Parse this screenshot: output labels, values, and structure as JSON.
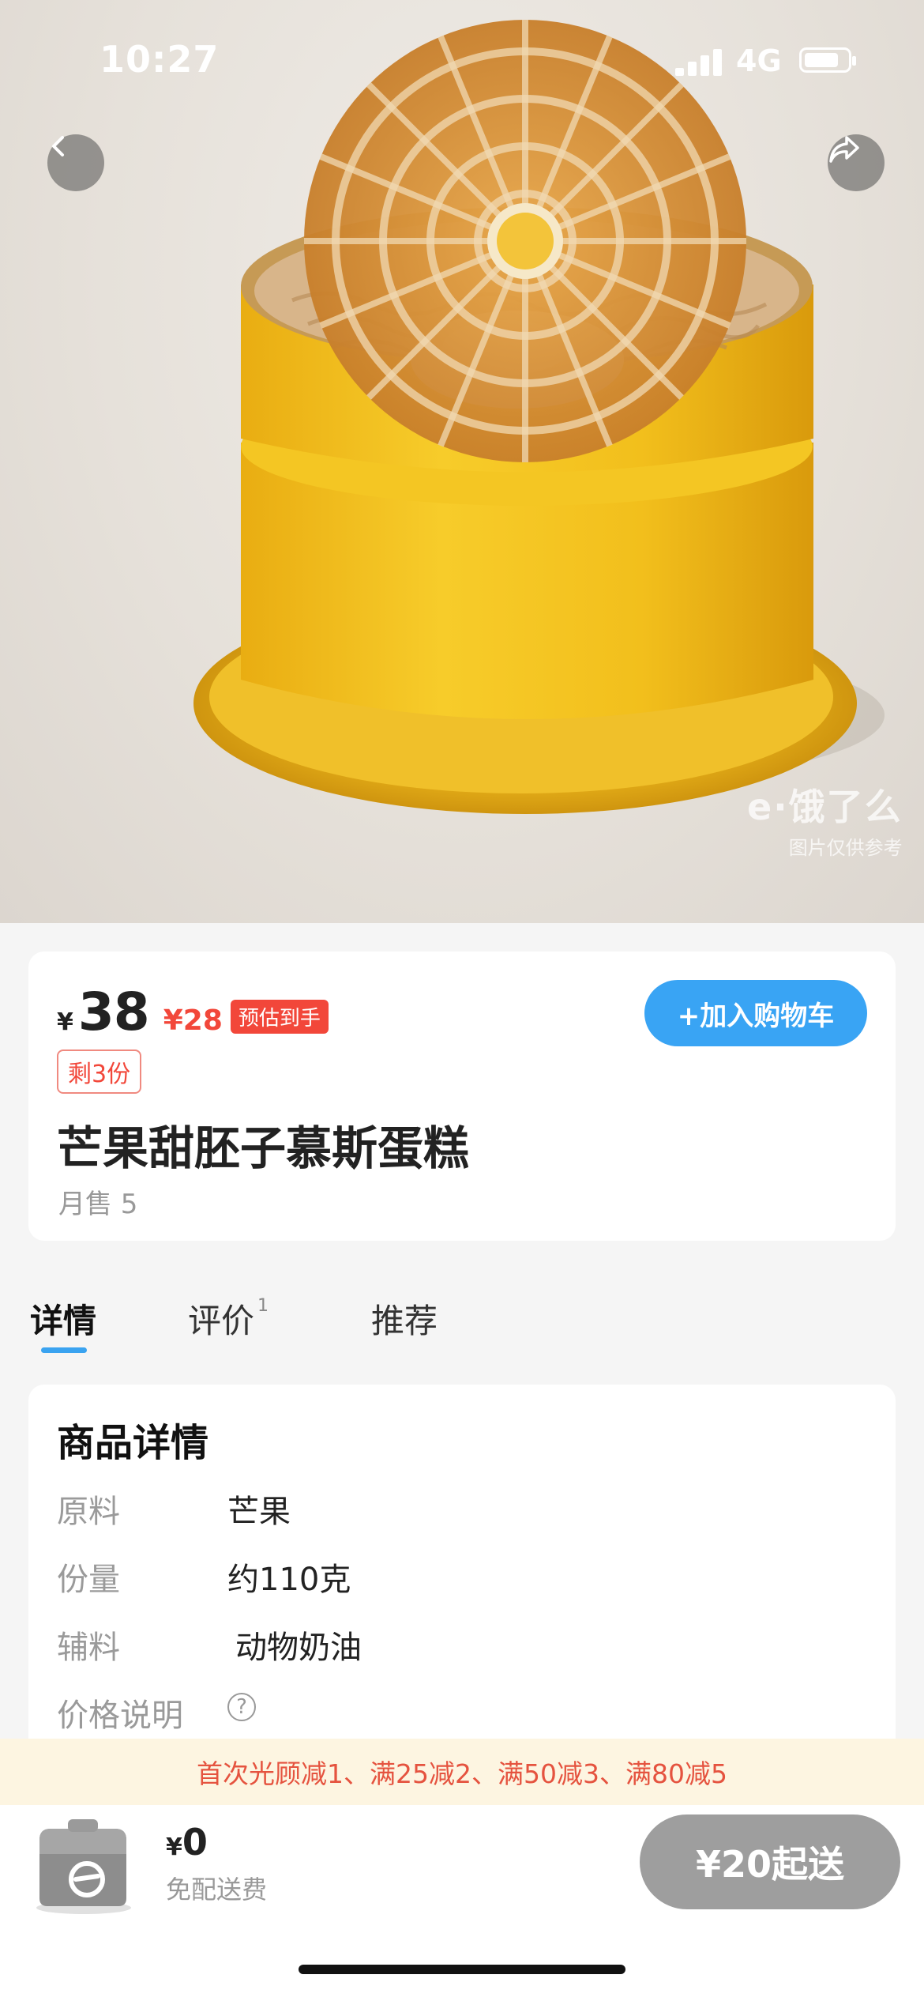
{
  "status_bar": {
    "time": "10:27",
    "network": "4G"
  },
  "hero": {
    "watermark_logo": "e·饿了么",
    "watermark_note": "图片仅供参考",
    "back_icon": "chevron-left-icon",
    "share_icon": "share-arrow-icon",
    "colors": {
      "cake_yellow": "#f3c11f",
      "cookie": "#d9923e"
    }
  },
  "product": {
    "currency": "¥",
    "price": "38",
    "discount_price": "¥28",
    "estimate_tag": "预估到手",
    "stock_tag": "剩3份",
    "add_to_cart": "+加入购物车",
    "title": "芒果甜胚子慕斯蛋糕",
    "monthly_sales": "月售 5"
  },
  "tabs": [
    {
      "label": "详情",
      "active": true
    },
    {
      "label": "评价",
      "badge": "1",
      "active": false
    },
    {
      "label": "推荐",
      "active": false
    }
  ],
  "details": {
    "heading": "商品详情",
    "rows": [
      {
        "key": "原料",
        "value": "芒果"
      },
      {
        "key": "份量",
        "value": "约110克"
      },
      {
        "key": "辅料",
        "value": "动物奶油"
      },
      {
        "key": "价格说明",
        "value": ""
      }
    ],
    "help_icon": "question-circle-icon"
  },
  "promo": {
    "text": "首次光顾减1、满25减2、满50减3、满80减5"
  },
  "cart": {
    "currency": "¥",
    "total": "0",
    "delivery_note": "免配送费",
    "min_order_button": "¥20起送",
    "cart_icon": "shopping-box-icon"
  },
  "colors": {
    "accent_blue": "#39a4f4",
    "price_red": "#f2473a",
    "promo_bg": "#fdf5e1"
  }
}
